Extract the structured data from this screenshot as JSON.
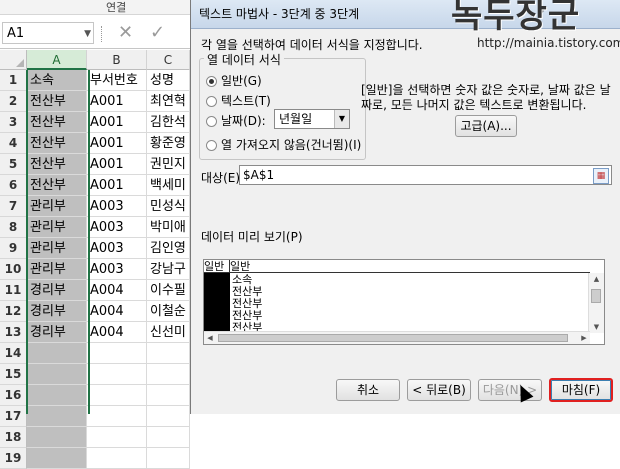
{
  "excel": {
    "ribbon_label": "연결",
    "namebox": "A1",
    "formula_icons": [
      "✕",
      "✓"
    ],
    "columns": [
      "A",
      "B",
      "C"
    ],
    "rows": [
      {
        "n": "1",
        "a": "소속",
        "b": "부서번호",
        "c": "성명"
      },
      {
        "n": "2",
        "a": "전산부",
        "b": "A001",
        "c": "최연혁"
      },
      {
        "n": "3",
        "a": "전산부",
        "b": "A001",
        "c": "김한석"
      },
      {
        "n": "4",
        "a": "전산부",
        "b": "A001",
        "c": "황준영"
      },
      {
        "n": "5",
        "a": "전산부",
        "b": "A001",
        "c": "권민지"
      },
      {
        "n": "6",
        "a": "전산부",
        "b": "A001",
        "c": "백세미"
      },
      {
        "n": "7",
        "a": "관리부",
        "b": "A003",
        "c": "민성식"
      },
      {
        "n": "8",
        "a": "관리부",
        "b": "A003",
        "c": "박미애"
      },
      {
        "n": "9",
        "a": "관리부",
        "b": "A003",
        "c": "김인영"
      },
      {
        "n": "10",
        "a": "관리부",
        "b": "A003",
        "c": "강남구"
      },
      {
        "n": "11",
        "a": "경리부",
        "b": "A004",
        "c": "이수필"
      },
      {
        "n": "12",
        "a": "경리부",
        "b": "A004",
        "c": "이철순"
      },
      {
        "n": "13",
        "a": "경리부",
        "b": "A004",
        "c": "신선미"
      },
      {
        "n": "14",
        "a": "",
        "b": "",
        "c": ""
      },
      {
        "n": "15",
        "a": "",
        "b": "",
        "c": ""
      },
      {
        "n": "16",
        "a": "",
        "b": "",
        "c": ""
      },
      {
        "n": "17",
        "a": "",
        "b": "",
        "c": ""
      },
      {
        "n": "18",
        "a": "",
        "b": "",
        "c": ""
      },
      {
        "n": "19",
        "a": "",
        "b": "",
        "c": ""
      }
    ]
  },
  "dialog": {
    "title": "텍스트 마법사 - 3단계 중 3단계",
    "help": "?",
    "watermark": "녹두장군",
    "watermark_url": "http://mainia.tistory.com",
    "instruction": "각 열을 선택하여 데이터 서식을 지정합니다.",
    "format_group": "열 데이터 서식",
    "options": {
      "general": "일반(G)",
      "text": "텍스트(T)",
      "date": "날짜(D):",
      "skip": "열 가져오지 않음(건너뜀)(I)"
    },
    "date_value": "년월일",
    "description": "[일반]을 선택하면 숫자 값은 숫자로, 날짜 값은 날짜로, 모든 나머지 값은 텍스트로 변환됩니다.",
    "advanced": "고급(A)...",
    "destination_label": "대상(E):",
    "destination_value": "$A$1",
    "preview_label": "데이터 미리 보기(P)",
    "preview": {
      "headers": [
        "일반",
        "일반"
      ],
      "lines": [
        "소속",
        "전산부",
        "전산부",
        "전산부",
        "전산부"
      ]
    },
    "buttons": {
      "cancel": "취소",
      "back": "< 뒤로(B)",
      "next": "다음(N) >",
      "finish": "마침(F)"
    }
  }
}
